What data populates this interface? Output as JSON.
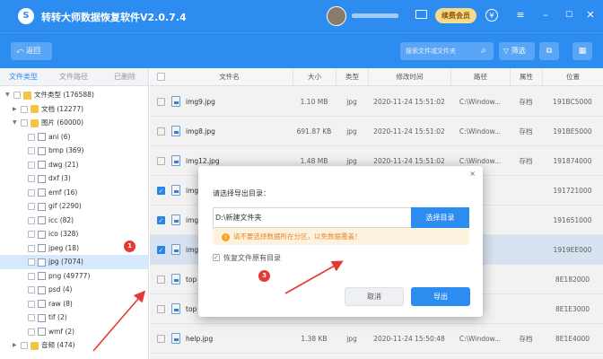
{
  "window": {
    "title": "转转大师数据恢复软件V2.0.7.4",
    "logo_glyph": "S",
    "vip_label": "续费会员",
    "username": "••••••••••"
  },
  "toolbar": {
    "back_label": "返回",
    "search_placeholder": "搜索文件或文件夹",
    "filter_label": "筛选"
  },
  "sidebar": {
    "tabs": [
      {
        "label": "文件类型",
        "active": true
      },
      {
        "label": "文件路径",
        "active": false
      },
      {
        "label": "已删除",
        "active": false
      }
    ],
    "tree": [
      {
        "label": "文件类型 (176588)",
        "level": 0,
        "expanded": true,
        "icon": "folder-icon"
      },
      {
        "label": "文档 (12277)",
        "level": 1,
        "expanded": false,
        "icon": "folder-icon"
      },
      {
        "label": "图片 (60000)",
        "level": 1,
        "expanded": true,
        "icon": "folder-icon"
      },
      {
        "label": "ani (6)",
        "level": 2,
        "icon": "file-icon"
      },
      {
        "label": "bmp (369)",
        "level": 2,
        "icon": "file-icon"
      },
      {
        "label": "dwg (21)",
        "level": 2,
        "icon": "file-icon"
      },
      {
        "label": "dxf (3)",
        "level": 2,
        "icon": "file-icon"
      },
      {
        "label": "emf (16)",
        "level": 2,
        "icon": "file-icon"
      },
      {
        "label": "gif (2290)",
        "level": 2,
        "icon": "file-icon"
      },
      {
        "label": "icc (82)",
        "level": 2,
        "icon": "file-icon"
      },
      {
        "label": "ico (328)",
        "level": 2,
        "icon": "file-icon"
      },
      {
        "label": "jpeg (18)",
        "level": 2,
        "icon": "file-icon"
      },
      {
        "label": "jpg (7074)",
        "level": 2,
        "icon": "file-icon",
        "selected": true
      },
      {
        "label": "png (49777)",
        "level": 2,
        "icon": "file-icon"
      },
      {
        "label": "psd (4)",
        "level": 2,
        "icon": "file-icon"
      },
      {
        "label": "raw (8)",
        "level": 2,
        "icon": "file-icon"
      },
      {
        "label": "tif (2)",
        "level": 2,
        "icon": "file-icon"
      },
      {
        "label": "wmf (2)",
        "level": 2,
        "icon": "file-icon"
      },
      {
        "label": "音频 (474)",
        "level": 1,
        "expanded": false,
        "icon": "folder-icon"
      }
    ]
  },
  "table": {
    "columns": [
      "文件名",
      "大小",
      "类型",
      "修改时间",
      "路径",
      "属性",
      "位置"
    ],
    "rows": [
      {
        "name": "img9.jpg",
        "size": "1.10 MB",
        "type": "jpg",
        "modified": "2020-11-24 15:51:02",
        "path": "C:\\Window...",
        "attr": "存档",
        "pos": "191BC5000",
        "checked": false
      },
      {
        "name": "img8.jpg",
        "size": "691.87 KB",
        "type": "jpg",
        "modified": "2020-11-24 15:51:02",
        "path": "C:\\Window...",
        "attr": "存档",
        "pos": "191BE5000",
        "checked": false
      },
      {
        "name": "img12.jpg",
        "size": "1.48 MB",
        "type": "jpg",
        "modified": "2020-11-24 15:51:02",
        "path": "C:\\Window...",
        "attr": "存档",
        "pos": "191874000",
        "checked": false
      },
      {
        "name": "img",
        "size": "",
        "type": "",
        "modified": "",
        "path": "",
        "attr": "",
        "pos": "191721000",
        "checked": true
      },
      {
        "name": "img",
        "size": "",
        "type": "",
        "modified": "",
        "path": "",
        "attr": "",
        "pos": "191651000",
        "checked": true
      },
      {
        "name": "img",
        "size": "",
        "type": "",
        "modified": "",
        "path": "",
        "attr": "",
        "pos": "1919EE000",
        "checked": true
      },
      {
        "name": "top",
        "size": "",
        "type": "",
        "modified": "",
        "path": "",
        "attr": "",
        "pos": "8E182000",
        "checked": false
      },
      {
        "name": "top",
        "size": "",
        "type": "",
        "modified": "",
        "path": "",
        "attr": "",
        "pos": "8E1E3000",
        "checked": false
      },
      {
        "name": "help.jpg",
        "size": "1.38 KB",
        "type": "jpg",
        "modified": "2020-11-24 15:50:48",
        "path": "C:\\Window...",
        "attr": "存档",
        "pos": "8E1E4000",
        "checked": false
      }
    ]
  },
  "dialog": {
    "close_glyph": "×",
    "title": "请选择导出目录：",
    "path_value": "D:\\新建文件夹",
    "choose_label": "选择目录",
    "warning": "请不要选择数据所在分区，以免数据覆盖！",
    "restore_label": "恢复文件原有目录",
    "restore_checked": true,
    "cancel_label": "取消",
    "export_label": "导出"
  },
  "markers": [
    {
      "label": "1"
    },
    {
      "label": "3"
    }
  ],
  "colors": {
    "primary": "#2d8cf0",
    "annotation_red": "#e53935"
  }
}
